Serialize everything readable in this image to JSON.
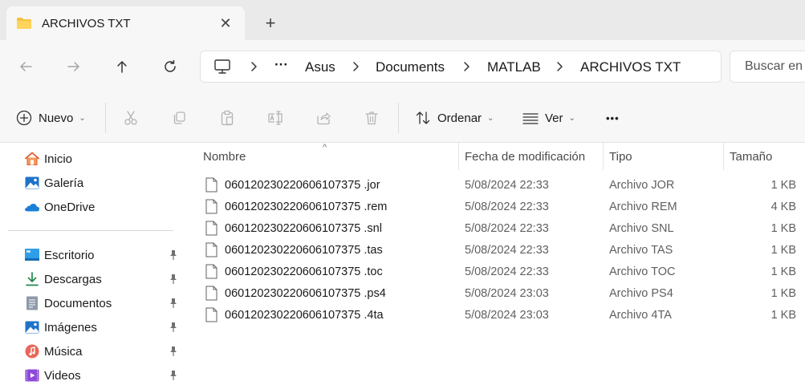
{
  "tab": {
    "title": "ARCHIVOS TXT",
    "close": "✕",
    "new_tab": "+"
  },
  "address": {
    "overflow": "···",
    "crumbs": [
      "Asus",
      "Documents",
      "MATLAB",
      "ARCHIVOS TXT"
    ]
  },
  "search": {
    "placeholder": "Buscar en ARCHIVOS TXT"
  },
  "toolbar": {
    "new_label": "Nuevo",
    "sort_label": "Ordenar",
    "view_label": "Ver",
    "more": "•••",
    "caret": "⌄"
  },
  "sidebar": {
    "top_items": [
      {
        "label": "Inicio",
        "icon": "home-icon"
      },
      {
        "label": "Galería",
        "icon": "gallery-icon"
      },
      {
        "label": "OneDrive",
        "icon": "onedrive-icon"
      }
    ],
    "pinned_items": [
      {
        "label": "Escritorio",
        "icon": "desktop-icon"
      },
      {
        "label": "Descargas",
        "icon": "downloads-icon"
      },
      {
        "label": "Documentos",
        "icon": "documents-icon"
      },
      {
        "label": "Imágenes",
        "icon": "pictures-icon"
      },
      {
        "label": "Música",
        "icon": "music-icon"
      },
      {
        "label": "Videos",
        "icon": "videos-icon"
      }
    ]
  },
  "columns": {
    "name": "Nombre",
    "date": "Fecha de modificación",
    "type": "Tipo",
    "size": "Tamaño",
    "sort_indicator": "^"
  },
  "files": [
    {
      "name": "06012023022060610737​5 .jor",
      "date": "5/08/2024 22:33",
      "type": "Archivo JOR",
      "size": "1 KB"
    },
    {
      "name": "060120230220606107375 .rem",
      "date": "5/08/2024 22:33",
      "type": "Archivo REM",
      "size": "4 KB"
    },
    {
      "name": "060120230220606107375 .snl",
      "date": "5/08/2024 22:33",
      "type": "Archivo SNL",
      "size": "1 KB"
    },
    {
      "name": "060120230220606107375 .tas",
      "date": "5/08/2024 22:33",
      "type": "Archivo TAS",
      "size": "1 KB"
    },
    {
      "name": "060120230220606107375 .toc",
      "date": "5/08/2024 22:33",
      "type": "Archivo TOC",
      "size": "1 KB"
    },
    {
      "name": "060120230220606107375 .ps4",
      "date": "5/08/2024 23:03",
      "type": "Archivo PS4",
      "size": "1 KB"
    },
    {
      "name": "060120230220606107375 .4ta",
      "date": "5/08/2024 23:03",
      "type": "Archivo 4TA",
      "size": "1 KB"
    }
  ],
  "colors": {
    "accent": "#0067c0",
    "folder": "#f5c342",
    "chrome": "#f7f7f7",
    "tabstrip": "#eaeaea"
  }
}
